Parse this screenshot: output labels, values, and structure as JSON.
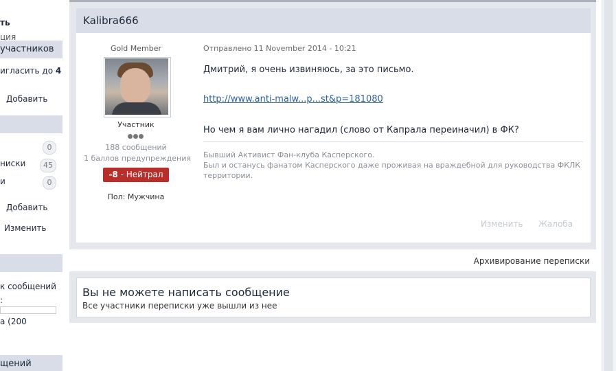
{
  "sidebar": {
    "fragments": {
      "top1": "ть",
      "top2": "ция",
      "header1": "участников",
      "invite": "игласить до",
      "invite_count": "4",
      "add1": "Добавить",
      "row1": "",
      "row1_count": "0",
      "row2": "ниски",
      "row2_count": "45",
      "row3": "и",
      "row3_count": "0",
      "add2": "Добавить",
      "edit": "Изменить",
      "msg_count": "к сообщений",
      "colon": ":",
      "limit": "а (200",
      "bottom": "щений"
    }
  },
  "post": {
    "author": "Kalibra666",
    "user_group": "Gold Member",
    "user_title": "Участник",
    "post_count": "188 сообщений",
    "warnings": "1 баллов предупреждения",
    "reputation_value": "-8",
    "reputation_label": " - Нейтрал",
    "gender_label": "Пол:",
    "gender_value": "Мужчина",
    "date": "Отправлено 11 November 2014 - 10:21",
    "line1": "Дмитрий, я очень извиняюсь, за это письмо.",
    "link": "http://www.anti-malw...p...st&p=181080",
    "line2": "Но чем я вам лично нагадил (слово от Капрала переиначил) в ФК?",
    "signature": [
      "Бывший Активист Фан-клуба Касперского.",
      "Был и останусь фанатом Касперского даже проживая на враждебной для руководства ФКЛК",
      "территории."
    ],
    "edit_label": "Изменить",
    "report_label": "Жалоба"
  },
  "archive_label": "Архивирование переписки",
  "notice": {
    "title": "Вы не можете написать сообщение",
    "subtitle": "Все участники переписки уже вышли из нее"
  },
  "colors": {
    "header_bg": "#d8dde8",
    "reputation_bg": "#b82e2b",
    "link": "#2b5fa8"
  }
}
